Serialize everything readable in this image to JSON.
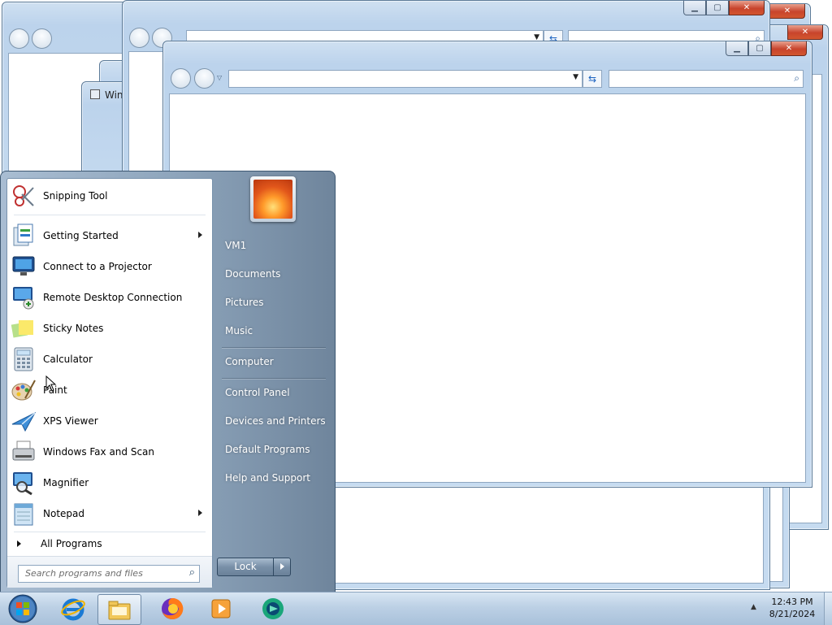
{
  "start_menu": {
    "programs": [
      {
        "label": "Snipping Tool",
        "icon": "snipping-tool-icon",
        "submenu": false
      },
      {
        "label": "Getting Started",
        "icon": "getting-started-icon",
        "submenu": true
      },
      {
        "label": "Connect to a Projector",
        "icon": "projector-icon",
        "submenu": false
      },
      {
        "label": "Remote Desktop Connection",
        "icon": "remote-desktop-icon",
        "submenu": false
      },
      {
        "label": "Sticky Notes",
        "icon": "sticky-notes-icon",
        "submenu": false
      },
      {
        "label": "Calculator",
        "icon": "calculator-icon",
        "submenu": false
      },
      {
        "label": "Paint",
        "icon": "paint-icon",
        "submenu": false
      },
      {
        "label": "XPS Viewer",
        "icon": "xps-viewer-icon",
        "submenu": false
      },
      {
        "label": "Windows Fax and Scan",
        "icon": "fax-scan-icon",
        "submenu": false
      },
      {
        "label": "Magnifier",
        "icon": "magnifier-icon",
        "submenu": false
      },
      {
        "label": "Notepad",
        "icon": "notepad-icon",
        "submenu": true
      }
    ],
    "all_programs_label": "All Programs",
    "search_placeholder": "Search programs and files",
    "right_items": [
      "VM1",
      "Documents",
      "Pictures",
      "Music",
      "Computer",
      "Control Panel",
      "Devices and Printers",
      "Default Programs",
      "Help and Support"
    ],
    "lock_label": "Lock"
  },
  "background_window": {
    "partial_title": "Win"
  },
  "taskbar": {
    "items": [
      "start-orb-icon",
      "internet-explorer-icon",
      "windows-explorer-icon",
      "firefox-icon",
      "media-player-icon",
      "app-icon"
    ],
    "time": "12:43 PM",
    "date": "8/21/2024"
  },
  "colors": {
    "start_menu_left_bg": "#ffffff",
    "start_menu_right_bg": "#7d94ab",
    "taskbar": "#bcd0e5",
    "close_button": "#c8442c"
  }
}
